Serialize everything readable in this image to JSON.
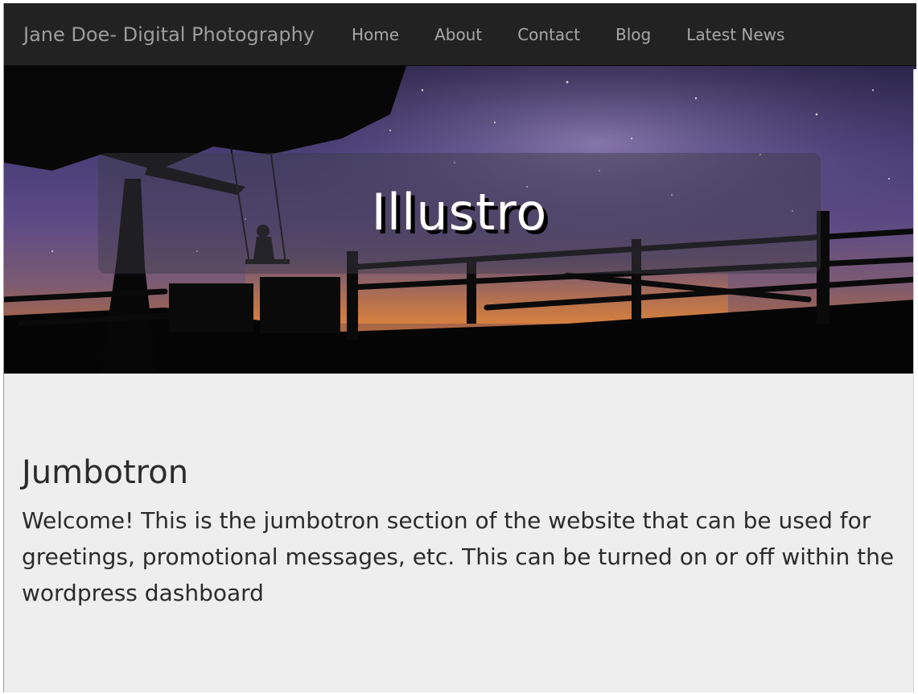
{
  "navbar": {
    "brand": "Jane Doe- Digital Photography",
    "links": [
      {
        "label": "Home"
      },
      {
        "label": "About"
      },
      {
        "label": "Contact"
      },
      {
        "label": "Blog"
      },
      {
        "label": "Latest News"
      }
    ]
  },
  "hero": {
    "title": "Illustro",
    "image_subject": "night sky with milky way, tree with swing, wooden fence silhouette"
  },
  "jumbotron": {
    "heading": "Jumbotron",
    "text": "Welcome! This is the jumbotron section of the website that can be used for greetings, promotional messages, etc. This can be turned on or off within the wordpress dashboard"
  },
  "colors": {
    "navbar_bg": "#222222",
    "nav_text": "#9d9d9d",
    "page_bg": "#eeeeee",
    "body_text": "#2b2b2b",
    "hero_title": "#ffffff"
  }
}
